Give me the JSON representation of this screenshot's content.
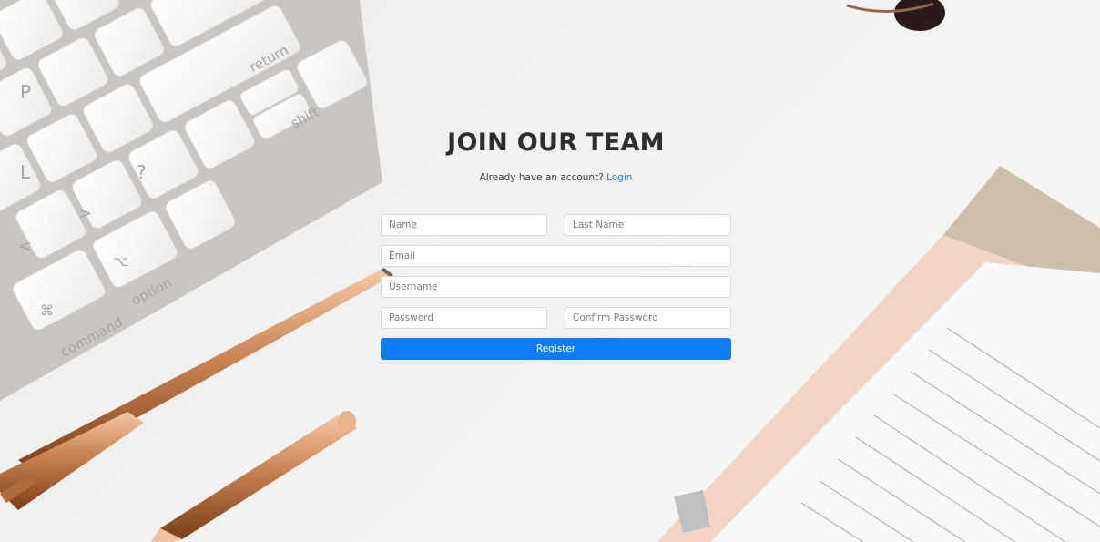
{
  "page": {
    "title": "JOIN OUR TEAM",
    "login_prompt": "Already have an account?",
    "login_link": "Login"
  },
  "form": {
    "name_placeholder": "Name",
    "last_name_placeholder": "Last Name",
    "email_placeholder": "Email",
    "username_placeholder": "Username",
    "password_placeholder": "Password",
    "confirm_password_placeholder": "Confirm Password",
    "register_label": "Register"
  },
  "keyboard": {
    "keys": [
      "return",
      "shift",
      "option",
      "command",
      "P",
      "L",
      "[",
      "{",
      "]",
      ";",
      ":",
      "?",
      "/",
      ">",
      "<",
      "\"",
      "⌥",
      "⌘"
    ]
  },
  "colors": {
    "accent": "#0d7cff",
    "link": "#1a7cff",
    "title": "#2b2f33",
    "background": "#f2f1ef"
  }
}
